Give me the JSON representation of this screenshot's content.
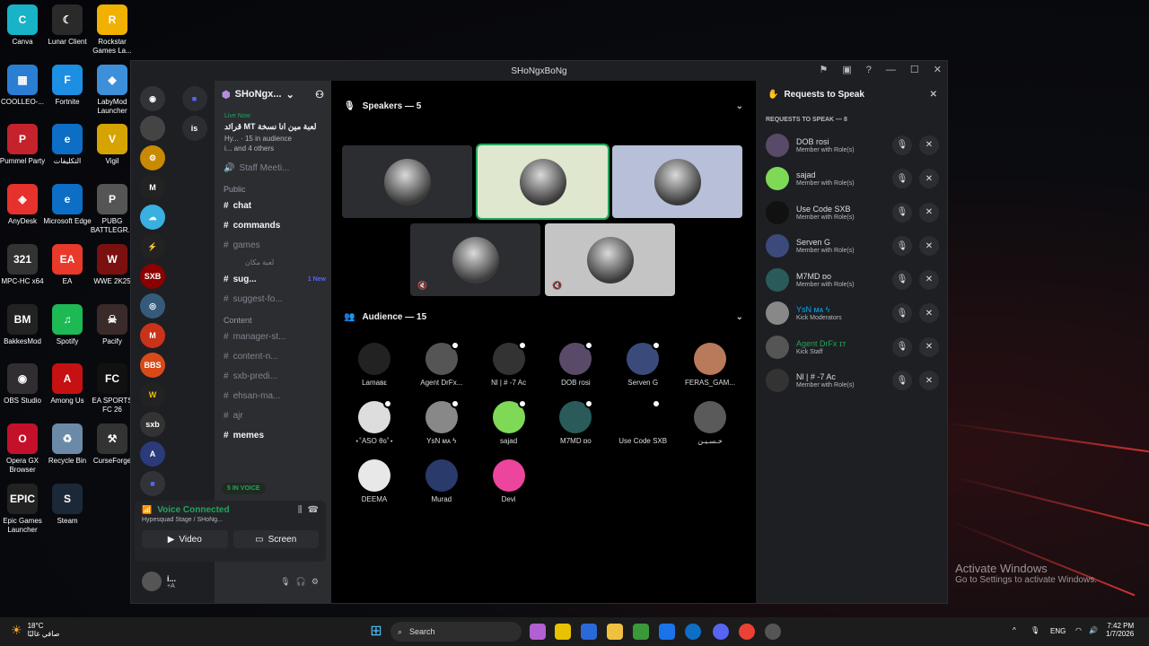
{
  "desktop_icons": [
    {
      "label": "Canva",
      "color": "#19b3c8",
      "glyph": "C"
    },
    {
      "label": "Lunar Client",
      "color": "#2a2a2a",
      "glyph": "☾"
    },
    {
      "label": "Rockstar Games La...",
      "color": "#f0b100",
      "glyph": "R"
    },
    {
      "label": "COOLLEO-...",
      "color": "#2a7fd4",
      "glyph": "▦"
    },
    {
      "label": "Fortnite",
      "color": "#1c8fe3",
      "glyph": "F"
    },
    {
      "label": "LabyMod Launcher",
      "color": "#3c8fd8",
      "glyph": "◆"
    },
    {
      "label": "Pummel Party",
      "color": "#c4232b",
      "glyph": "P"
    },
    {
      "label": "التكليفات",
      "color": "#0c6fc5",
      "glyph": "e"
    },
    {
      "label": "Vigil",
      "color": "#d5a400",
      "glyph": "V"
    },
    {
      "label": "AnyDesk",
      "color": "#e5322d",
      "glyph": "◈"
    },
    {
      "label": "Microsoft Edge",
      "color": "#0c6fc5",
      "glyph": "e"
    },
    {
      "label": "PUBG BATTLEGR...",
      "color": "#555",
      "glyph": "P"
    },
    {
      "label": "MPC-HC x64",
      "color": "#333",
      "glyph": "321"
    },
    {
      "label": "EA",
      "color": "#e8392b",
      "glyph": "EA"
    },
    {
      "label": "WWE 2K25",
      "color": "#7a1010",
      "glyph": "W"
    },
    {
      "label": "BakkesMod",
      "color": "#222",
      "glyph": "BM"
    },
    {
      "label": "Spotify",
      "color": "#1db954",
      "glyph": "♫"
    },
    {
      "label": "Pacify",
      "color": "#3a2a2a",
      "glyph": "☠"
    },
    {
      "label": "OBS Studio",
      "color": "#302e31",
      "glyph": "◉"
    },
    {
      "label": "Among Us",
      "color": "#c51111",
      "glyph": "A"
    },
    {
      "label": "EA SPORTS FC 26",
      "color": "#111",
      "glyph": "FC"
    },
    {
      "label": "Opera GX Browser",
      "color": "#c4102a",
      "glyph": "O"
    },
    {
      "label": "Recycle Bin",
      "color": "#6a8aa8",
      "glyph": "♻"
    },
    {
      "label": "CurseForge",
      "color": "#333",
      "glyph": "⚒"
    },
    {
      "label": "Epic Games Launcher",
      "color": "#222",
      "glyph": "EPIC"
    },
    {
      "label": "Steam",
      "color": "#1b2838",
      "glyph": "S"
    }
  ],
  "watermark": {
    "line1": "Activate Windows",
    "line2": "Go to Settings to activate Windows."
  },
  "window": {
    "title": "SHoNgxBoNg"
  },
  "servers": {
    "dm_is": "is"
  },
  "server_header": {
    "name": "SHoNgx..."
  },
  "live": {
    "tag": "Live Now",
    "name": "قرائد MT لعبة مين انا نسخة",
    "line2": "Hy... · 15 in audience",
    "line3": "i... and 4 others"
  },
  "channels": [
    {
      "name": "Staff Meeti...",
      "unread": false,
      "type": "voice"
    },
    {
      "category": "Public"
    },
    {
      "name": "chat",
      "unread": true,
      "type": "text"
    },
    {
      "name": "commands",
      "unread": true,
      "type": "text"
    },
    {
      "name": "games",
      "unread": false,
      "type": "text"
    },
    {
      "name": "لعبة مكان",
      "unread": false,
      "type": "sub"
    },
    {
      "name": "sug...",
      "unread": true,
      "type": "text",
      "badge": "1 New"
    },
    {
      "name": "suggest-fo...",
      "unread": false,
      "type": "text"
    },
    {
      "category": "Content"
    },
    {
      "name": "manager-st...",
      "unread": false,
      "type": "text"
    },
    {
      "name": "content-n...",
      "unread": false,
      "type": "text"
    },
    {
      "name": "sxb-predi...",
      "unread": false,
      "type": "text"
    },
    {
      "name": "ehsan-ma...",
      "unread": false,
      "type": "text"
    },
    {
      "name": "ajr",
      "unread": false,
      "type": "text"
    },
    {
      "name": "memes",
      "unread": true,
      "type": "text"
    }
  ],
  "in_voice": "5 IN VOICE",
  "voice": {
    "status": "Voice Connected",
    "sub": "Hypesquad Stage / SHoNg...",
    "video": "Video",
    "screen": "Screen"
  },
  "user": {
    "name": "i...",
    "status": "+A"
  },
  "stage": {
    "speakers_title": "Speakers — 5",
    "audience_title": "Audience — 15"
  },
  "speaker_tiles": [
    {
      "bg": "#2b2d31",
      "muted": false
    },
    {
      "bg": "#dfe8cf",
      "muted": false,
      "active": true
    },
    {
      "bg": "#b8bfd8",
      "muted": false
    },
    {
      "bg": "#2b2d31",
      "muted": true
    },
    {
      "bg": "#c4c4c4",
      "muted": true
    }
  ],
  "audience": [
    {
      "name": "Lamaвε",
      "color": "#222"
    },
    {
      "name": "Agent DrFx...",
      "color": "#555"
    },
    {
      "name": "Nl | # -7 Ac",
      "color": "#333"
    },
    {
      "name": "DOB rosi",
      "color": "#5a4a6a"
    },
    {
      "name": "Serven G",
      "color": "#3a4a7a"
    },
    {
      "name": "FERAS_GAM...",
      "color": "#b87a5a"
    },
    {
      "name": "⋆˚ASO θɢ˚⋆",
      "color": "#ddd"
    },
    {
      "name": "YsN ᴍᴀ ϟ",
      "color": "#888"
    },
    {
      "name": "sajad",
      "color": "#7ed957"
    },
    {
      "name": "M7MD ɒo",
      "color": "#2a5a5a"
    },
    {
      "name": "Use Code SXB",
      "color": "#000"
    },
    {
      "name": "خـسـيـن",
      "color": "#5a5a5a"
    },
    {
      "name": "DEEMA",
      "color": "#e8e8e8"
    },
    {
      "name": "Murad",
      "color": "#2a3a6a"
    },
    {
      "name": "Devi",
      "color": "#eb459e"
    }
  ],
  "requests": {
    "title": "Requests to Speak",
    "subtitle": "REQUESTS TO SPEAK — 8",
    "items": [
      {
        "name": "DOB rosi",
        "role": "Member with Role(s)",
        "color": "#5a4a6a",
        "name_color": "#dbdee1"
      },
      {
        "name": "sajad",
        "role": "Member with Role(s)",
        "color": "#7ed957",
        "name_color": "#dbdee1"
      },
      {
        "name": "Use Code SXB",
        "role": "Member with Role(s)",
        "color": "#111",
        "name_color": "#dbdee1"
      },
      {
        "name": "Serven G",
        "role": "Member with Role(s)",
        "color": "#3a4a7a",
        "name_color": "#dbdee1"
      },
      {
        "name": "M7MD ɒo",
        "role": "Member with Role(s)",
        "color": "#2a5a5a",
        "name_color": "#dbdee1"
      },
      {
        "name": "YsN ᴍᴀ ϟ",
        "role": "Kick Moderators",
        "color": "#888",
        "name_color": "#00a8fc"
      },
      {
        "name": "Agent DrFx ɪᴛ",
        "role": "Kick Staff",
        "color": "#555",
        "name_color": "#23a55a"
      },
      {
        "name": "Nl | # -7 Ac",
        "role": "Member with Role(s)",
        "color": "#333",
        "name_color": "#dbdee1"
      }
    ]
  },
  "taskbar": {
    "weather_temp": "18°C",
    "weather_desc": "صافي غالبًا",
    "search": "Search",
    "lang": "ENG",
    "time": "7:42 PM",
    "date": "1/7/2026"
  }
}
